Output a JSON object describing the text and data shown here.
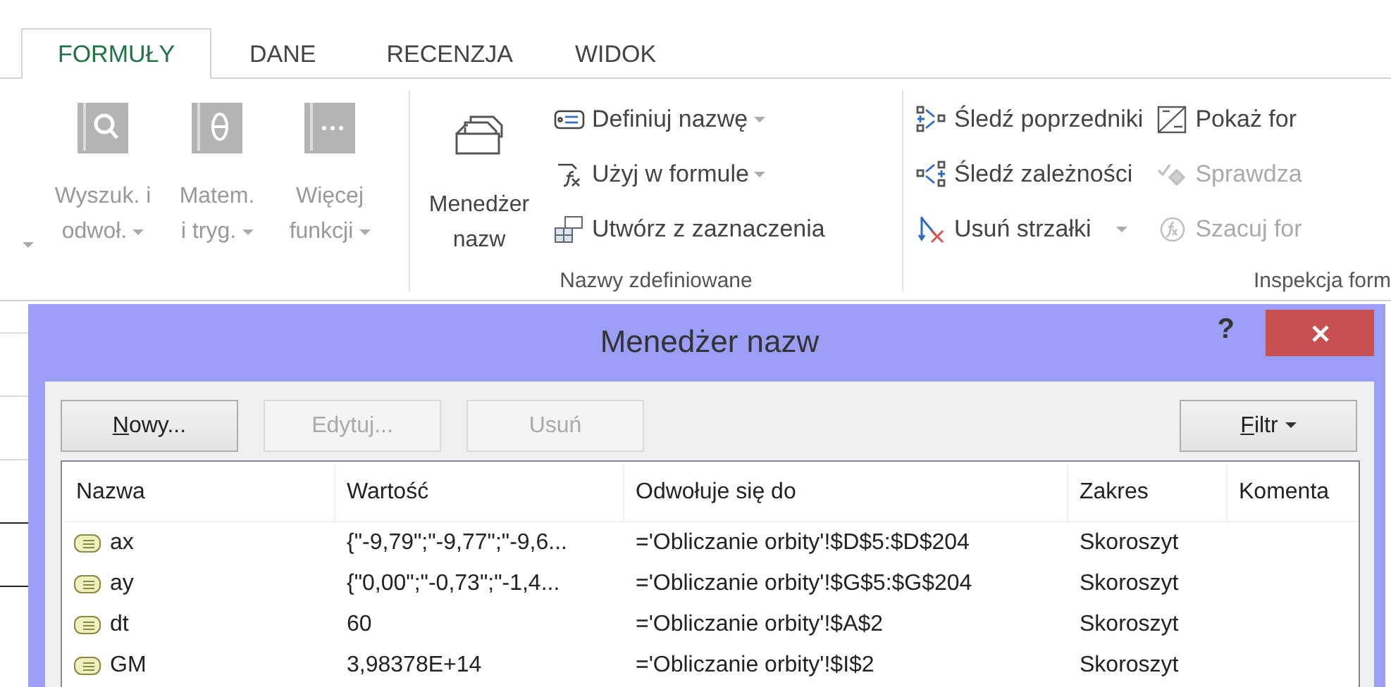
{
  "tabs": [
    {
      "label": "FORMUŁY",
      "selected": true
    },
    {
      "label": "DANE",
      "selected": false
    },
    {
      "label": "RECENZJA",
      "selected": false
    },
    {
      "label": "WIDOK",
      "selected": false
    }
  ],
  "function_library": {
    "buttons": [
      {
        "lines": [
          "Wyszuk. i",
          "odwoł."
        ],
        "disabled": true
      },
      {
        "lines": [
          "Matem.",
          "i tryg."
        ],
        "disabled": true
      },
      {
        "lines": [
          "Więcej",
          "funkcji"
        ],
        "disabled": true
      }
    ]
  },
  "defined_names": {
    "manager_button": {
      "lines": [
        "Menedżer",
        "nazw"
      ]
    },
    "commands": [
      {
        "label": "Definiuj nazwę",
        "dropdown": true
      },
      {
        "label": "Użyj w formule",
        "dropdown": true
      },
      {
        "label": "Utwórz z zaznaczenia",
        "dropdown": false
      }
    ],
    "group_label": "Nazwy zdefiniowane"
  },
  "formula_auditing": {
    "columns": [
      [
        {
          "label": "Śledź poprzedniki",
          "disabled": false,
          "dropdown": false
        },
        {
          "label": "Śledź zależności",
          "disabled": false,
          "dropdown": false
        },
        {
          "label": "Usuń strzałki",
          "disabled": false,
          "dropdown": true
        }
      ],
      [
        {
          "label": "Pokaż for",
          "disabled": false,
          "dropdown": false
        },
        {
          "label": "Sprawdza",
          "disabled": true,
          "dropdown": false
        },
        {
          "label": "Szacuj for",
          "disabled": true,
          "dropdown": false
        }
      ]
    ],
    "group_label": "Inspekcja form"
  },
  "dialog": {
    "title": "Menedżer nazw",
    "help": "?",
    "buttons": [
      {
        "label": "Nowy...",
        "disabled": false,
        "underline_first": true
      },
      {
        "label": "Edytuj...",
        "disabled": true,
        "underline_first": false
      },
      {
        "label": "Usuń",
        "disabled": true,
        "underline_first": false
      }
    ],
    "filter_button": {
      "label": "Filtr",
      "underline_first": true
    },
    "table": {
      "columns": [
        "Nazwa",
        "Wartość",
        "Odwołuje się do",
        "Zakres",
        "Komenta"
      ],
      "rows": [
        [
          "ax",
          "{\"-9,79\";\"-9,77\";\"-9,6...",
          "='Obliczanie orbity'!$D$5:$D$204",
          "Skoroszyt"
        ],
        [
          "ay",
          "{\"0,00\";\"-0,73\";\"-1,4...",
          "='Obliczanie orbity'!$G$5:$G$204",
          "Skoroszyt"
        ],
        [
          "dt",
          "60",
          "='Obliczanie orbity'!$A$2",
          "Skoroszyt"
        ],
        [
          "GM",
          "3,98378E+14",
          "='Obliczanie orbity'!$I$2",
          "Skoroszyt"
        ]
      ]
    }
  }
}
